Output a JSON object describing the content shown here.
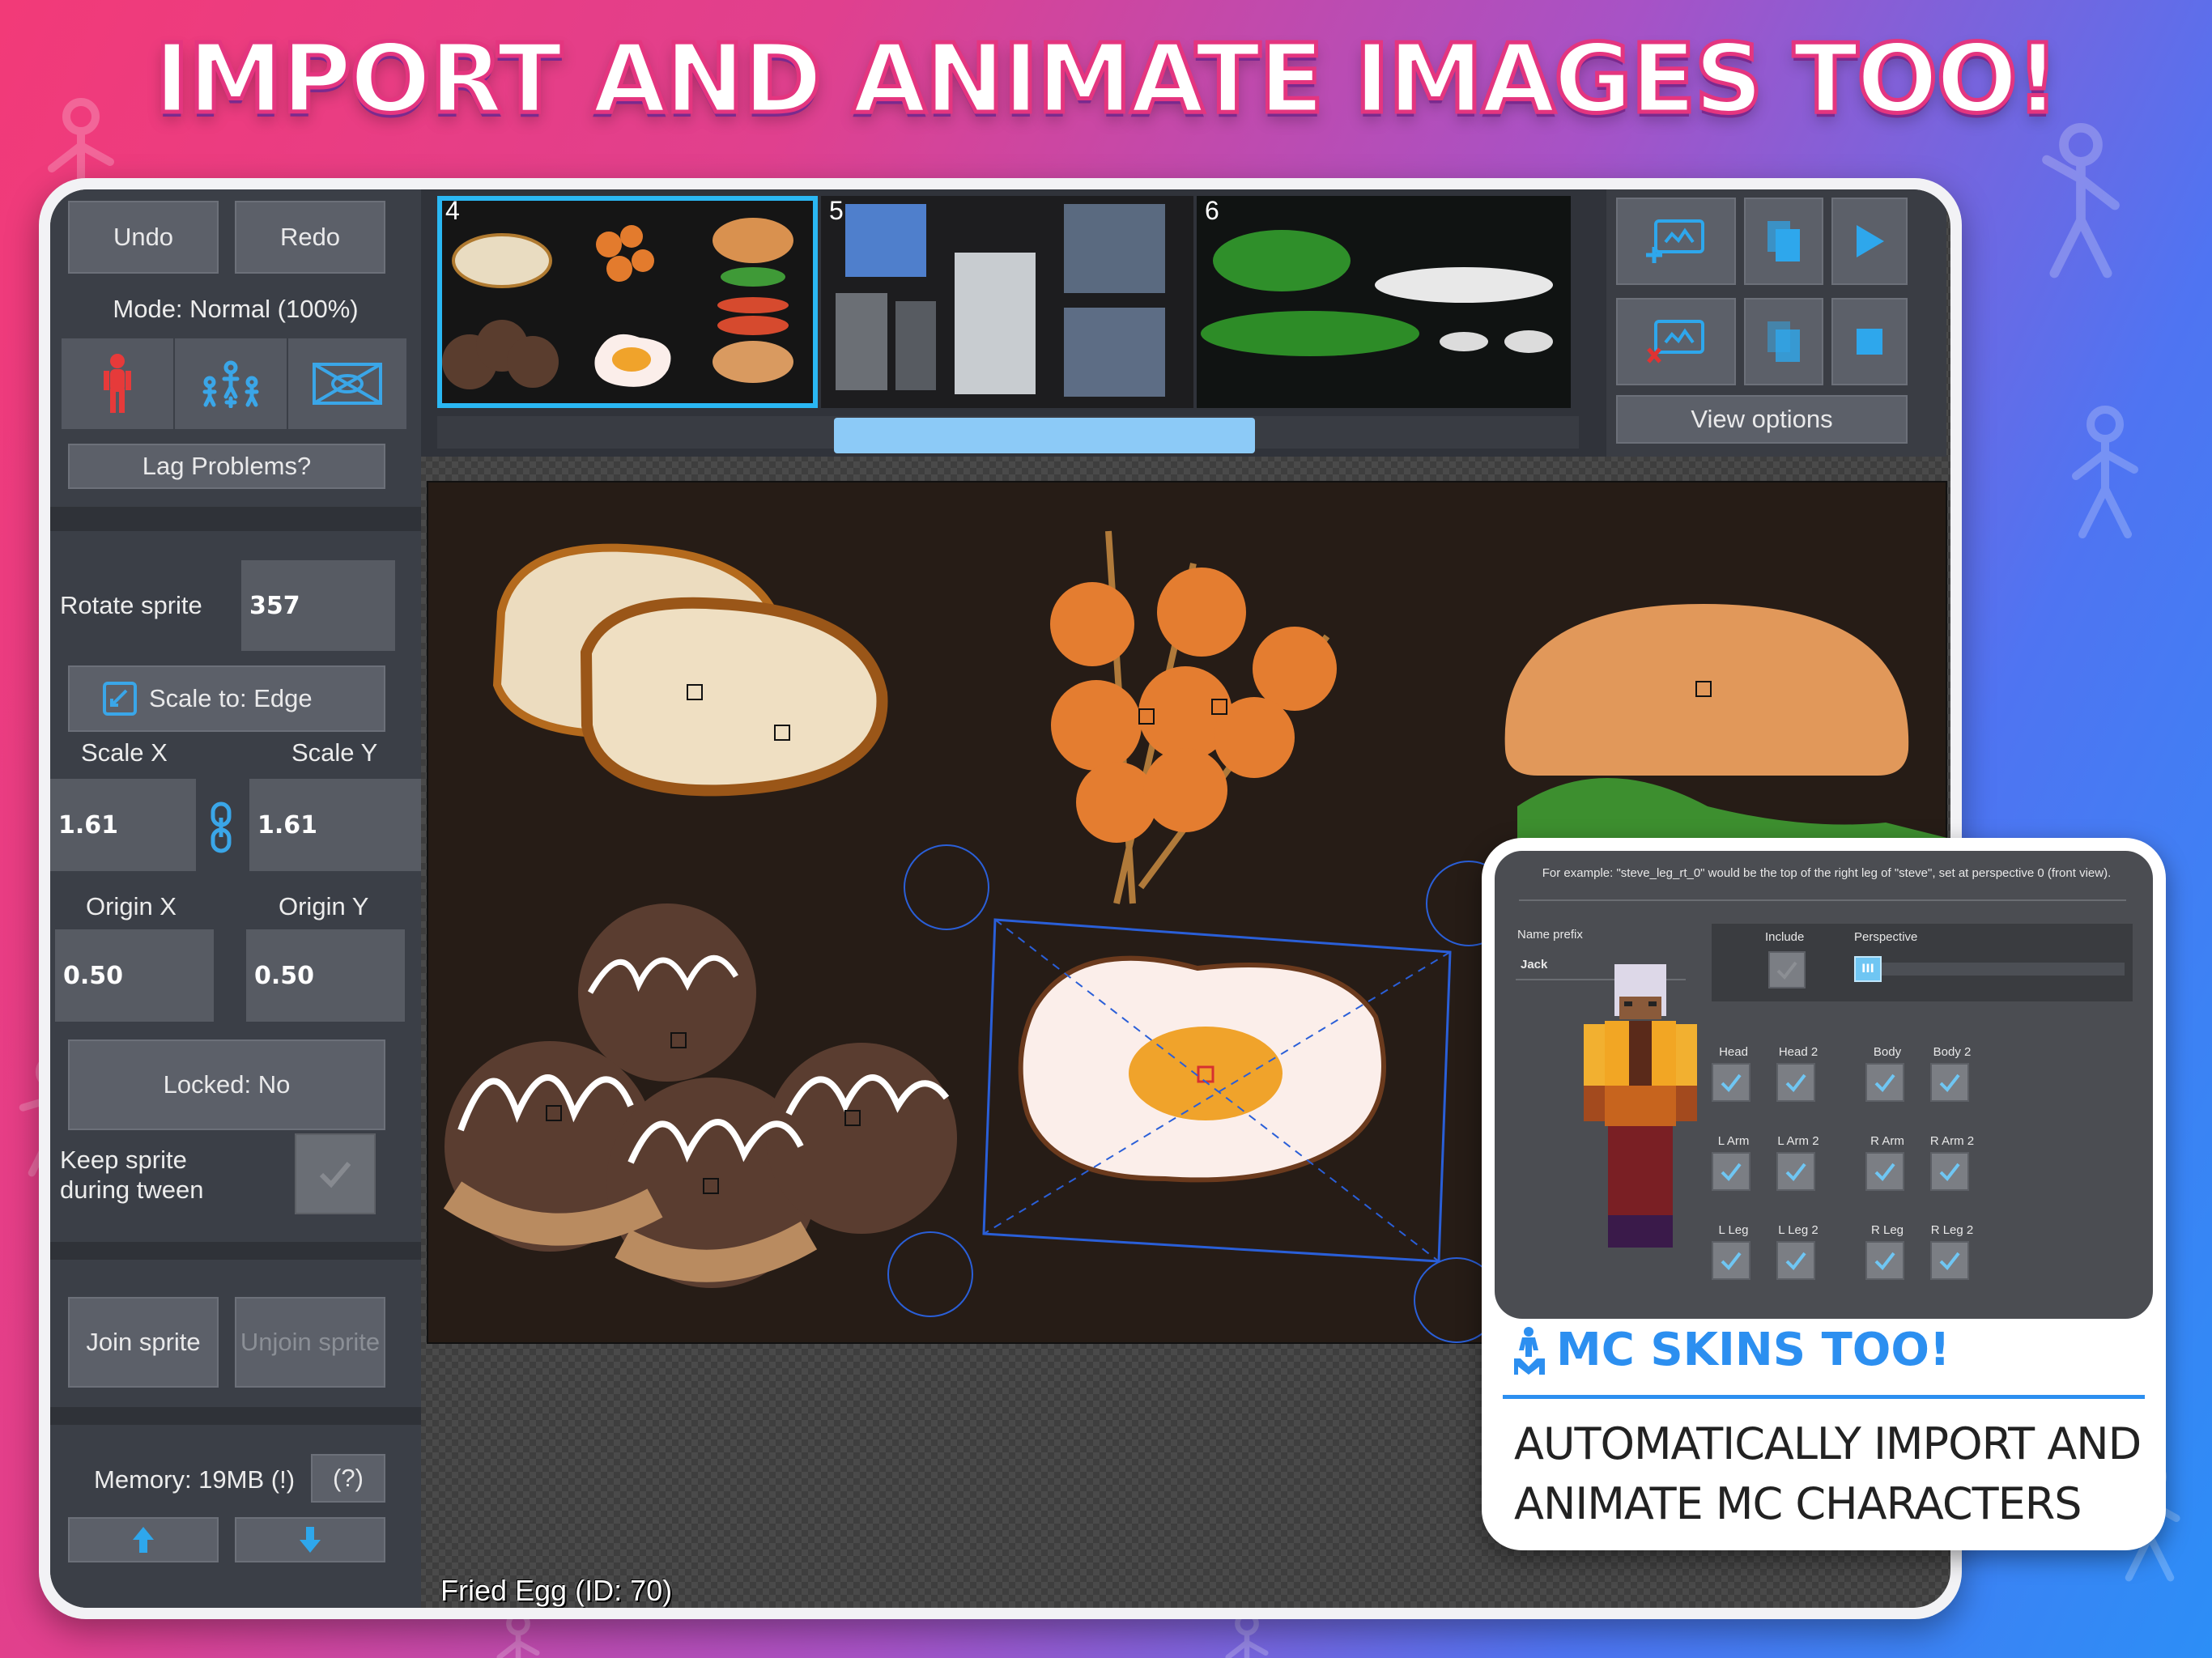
{
  "headline": "IMPORT AND ANIMATE IMAGES TOO!",
  "left": {
    "undo": "Undo",
    "redo": "Redo",
    "mode": "Mode: Normal (100%)",
    "lag": "Lag Problems?",
    "rotate_label": "Rotate sprite",
    "rotate_value": "357",
    "scale_to": "Scale to: Edge",
    "scale_x_label": "Scale X",
    "scale_y_label": "Scale Y",
    "scale_x": "1.61",
    "scale_y": "1.61",
    "origin_x_label": "Origin X",
    "origin_y_label": "Origin Y",
    "origin_x": "0.50",
    "origin_y": "0.50",
    "locked": "Locked: No",
    "keep_line1": "Keep sprite",
    "keep_line2": "during tween",
    "join": "Join sprite",
    "unjoin": "Unjoin sprite",
    "memory": "Memory: 19MB (!)",
    "help": "(?)"
  },
  "frames": [
    {
      "num": "4",
      "selected": true
    },
    {
      "num": "5",
      "selected": false
    },
    {
      "num": "6",
      "selected": false
    }
  ],
  "controls": {
    "view_options": "View options"
  },
  "status": "Fried Egg (ID: 70)",
  "card": {
    "example": "For example: \"steve_leg_rt_0\" would be the top of the right leg of \"steve\", set at perspective 0 (front view).",
    "name_prefix_label": "Name prefix",
    "name_prefix_value": "Jack",
    "include_label": "Include",
    "perspective_label": "Perspective",
    "perspective_value": "III",
    "parts": [
      "Head",
      "Head 2",
      "Body",
      "Body 2",
      "L Arm",
      "L Arm 2",
      "R Arm",
      "R Arm 2",
      "L Leg",
      "L Leg 2",
      "R Leg",
      "R Leg 2"
    ],
    "title": "MC SKINS TOO!",
    "body_line1": "AUTOMATICALLY IMPORT AND",
    "body_line2": "ANIMATE MC CHARACTERS"
  },
  "colors": {
    "accent": "#2ab7f3",
    "panel": "#3b3f47",
    "button": "#5c6069",
    "card_title": "#2c8ff0"
  }
}
